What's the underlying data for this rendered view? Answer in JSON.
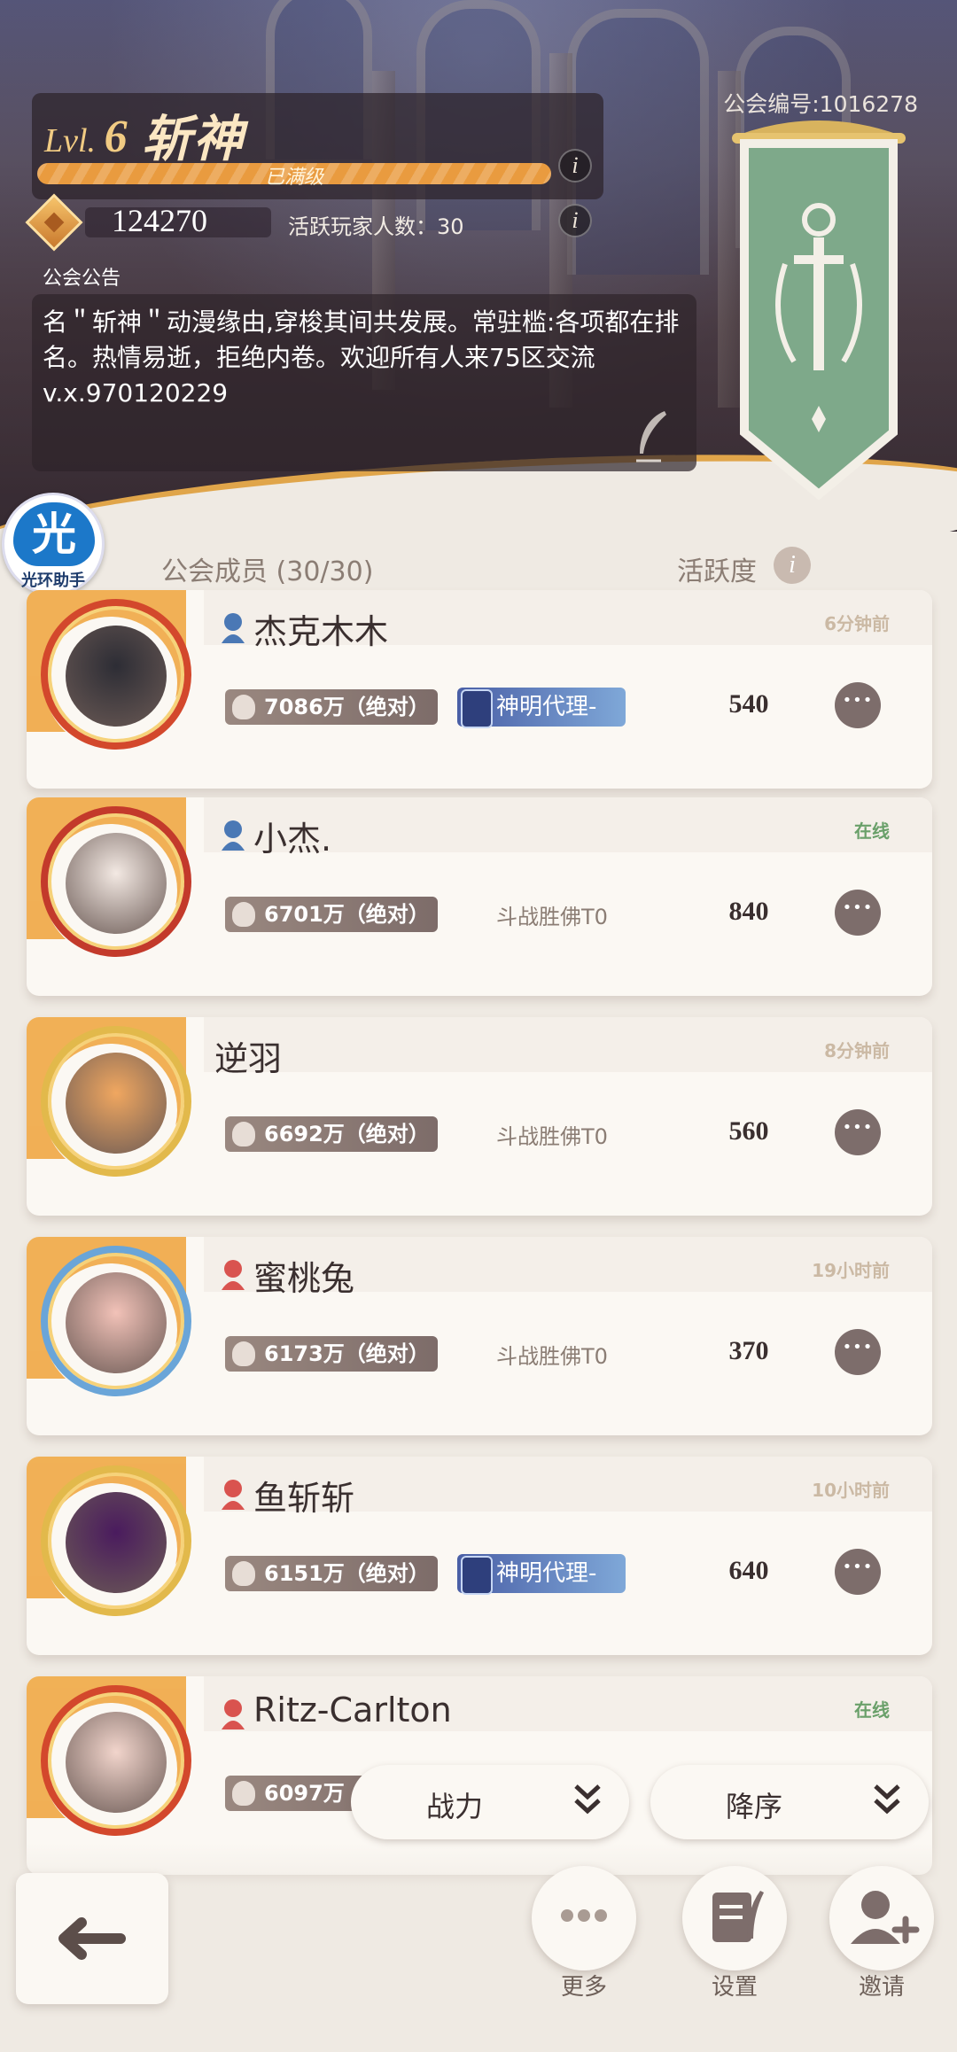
{
  "guild": {
    "level_prefix": "Lvl.",
    "level": "6",
    "name": "斩神",
    "progress_label": "已满级",
    "progress_fraction": 1.0,
    "score": "124270",
    "active_players": "活跃玩家人数：30",
    "id_label": "公会编号:1016278",
    "notice_title": "公会公告",
    "notice_text": "名＂斩神＂动漫缘由,穿梭其间共发展。常驻槛:各项都在排名。热情易逝，拒绝内卷。欢迎所有人来75区交流v.x.970120229"
  },
  "helper": {
    "glyph": "光",
    "label": "光环助手"
  },
  "members_header": {
    "title": "公会成员 (30/30)",
    "activity": "活跃度"
  },
  "members": [
    {
      "name": "杰克木木",
      "last_seen": "6分钟前",
      "online": false,
      "power": "7086万（绝对）",
      "title": "神明代理-",
      "title_kind": "badge",
      "activity": "540",
      "role_color": "#4a78b5",
      "avatar_color": "#2d2d35",
      "ring_color": "#d3482c"
    },
    {
      "name": "小杰.",
      "last_seen": "在线",
      "online": true,
      "power": "6701万（绝对）",
      "title": "斗战胜佛T0",
      "title_kind": "text",
      "activity": "840",
      "role_color": "#4a78b5",
      "avatar_color": "#f3e9e3",
      "ring_color": "#c33a2b"
    },
    {
      "name": "逆羽",
      "last_seen": "8分钟前",
      "online": false,
      "power": "6692万（绝对）",
      "title": "斗战胜佛T0",
      "title_kind": "text",
      "activity": "560",
      "role_color": "",
      "avatar_color": "#f0a760",
      "ring_color": "#e2b94b"
    },
    {
      "name": "蜜桃兔",
      "last_seen": "19小时前",
      "online": false,
      "power": "6173万（绝对）",
      "title": "斗战胜佛T0",
      "title_kind": "text",
      "activity": "370",
      "role_color": "#d9534f",
      "avatar_color": "#f2c2b8",
      "ring_color": "#6aa5d8"
    },
    {
      "name": "鱼斩斩",
      "last_seen": "10小时前",
      "online": false,
      "power": "6151万（绝对）",
      "title": "神明代理-",
      "title_kind": "badge",
      "activity": "640",
      "role_color": "#d9534f",
      "avatar_color": "#4a1b5e",
      "ring_color": "#e2b94b"
    },
    {
      "name": "Ritz-Carlton",
      "last_seen": "在线",
      "online": true,
      "power": "6097万",
      "title": "",
      "title_kind": "none",
      "activity": "",
      "role_color": "#d9534f",
      "avatar_color": "#f2d5cc",
      "ring_color": "#d3482c"
    }
  ],
  "sort": {
    "field": "战力",
    "order": "降序"
  },
  "bottom": {
    "more": "更多",
    "settings": "设置",
    "invite": "邀请"
  },
  "colors": {
    "accent_orange": "#e99b3f",
    "banner_green": "#7ea98a",
    "card_bg": "#fbf8f3"
  }
}
